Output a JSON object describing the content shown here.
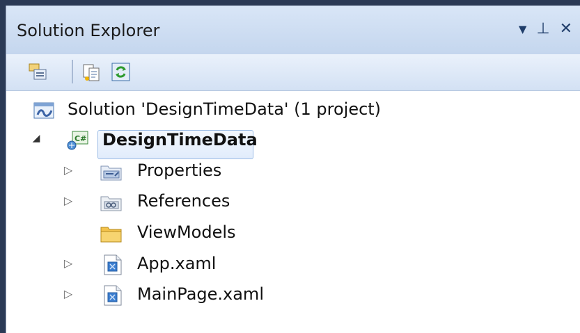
{
  "panel": {
    "title": "Solution Explorer",
    "controls": {
      "dropdown": "▼",
      "pin": "⊥",
      "close": "✕"
    }
  },
  "toolbar": {
    "buttons": [
      {
        "icon": "properties-icon"
      },
      {
        "icon": "show-all-files-icon"
      },
      {
        "icon": "refresh-icon"
      }
    ]
  },
  "tree": {
    "solution": {
      "label": "Solution 'DesignTimeData' (1 project)",
      "icon": "solution-icon"
    },
    "project": {
      "label": "DesignTimeData",
      "icon": "csharp-project-icon",
      "expanded": true
    },
    "items": [
      {
        "label": "Properties",
        "icon": "properties-folder-icon",
        "expandable": true
      },
      {
        "label": "References",
        "icon": "references-folder-icon",
        "expandable": true
      },
      {
        "label": "ViewModels",
        "icon": "folder-icon",
        "expandable": false,
        "selected": true
      },
      {
        "label": "App.xaml",
        "icon": "xaml-file-icon",
        "expandable": true
      },
      {
        "label": "MainPage.xaml",
        "icon": "xaml-file-icon",
        "expandable": true
      }
    ]
  },
  "colors": {
    "title_bar": "#c4d6ee",
    "selection_border": "#9cbce6",
    "folder": "#f3c24b"
  }
}
